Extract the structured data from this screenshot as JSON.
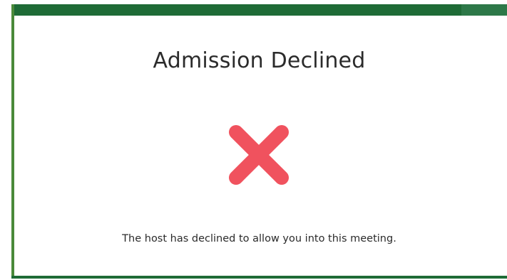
{
  "dialog": {
    "title": "Admission Declined",
    "icon": "close-x-icon",
    "message": "The host has declined to allow you into this meeting."
  },
  "colors": {
    "accent_bar": "#1e6b36",
    "icon": "#f0525e",
    "text": "#2b2b2b"
  }
}
